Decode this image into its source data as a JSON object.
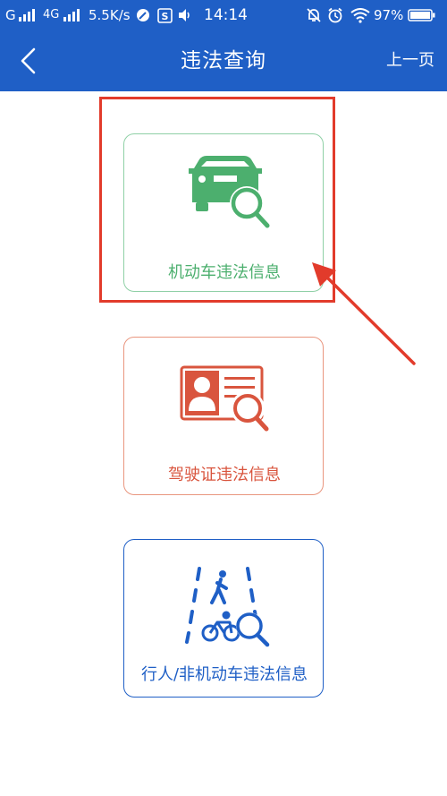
{
  "status_bar": {
    "carrier1": "G",
    "carrier2": "4G",
    "net_speed": "5.5K/s",
    "time": "14:14",
    "battery": "97%",
    "icons": [
      "signal-icon",
      "signal-icon",
      "compass-icon",
      "s-badge-icon",
      "volume-icon",
      "mute-bell-icon",
      "alarm-icon",
      "wifi-icon",
      "battery-icon"
    ]
  },
  "nav": {
    "back_icon": "chevron-left-icon",
    "title": "违法查询",
    "prev_page": "上一页"
  },
  "cards": [
    {
      "label": "机动车违法信息",
      "icon": "car-search-icon",
      "color": "#4caf6e",
      "border": "#8fd0a6",
      "highlighted": true
    },
    {
      "label": "驾驶证违法信息",
      "icon": "license-search-icon",
      "color": "#d9553e",
      "border": "#e9967f"
    },
    {
      "label": "行人/非机动车违法信息",
      "icon": "pedestrian-bike-search-icon",
      "color": "#1f5fc6",
      "border": "#1f5fc6"
    }
  ],
  "annotation": {
    "color": "#e23b2b"
  }
}
